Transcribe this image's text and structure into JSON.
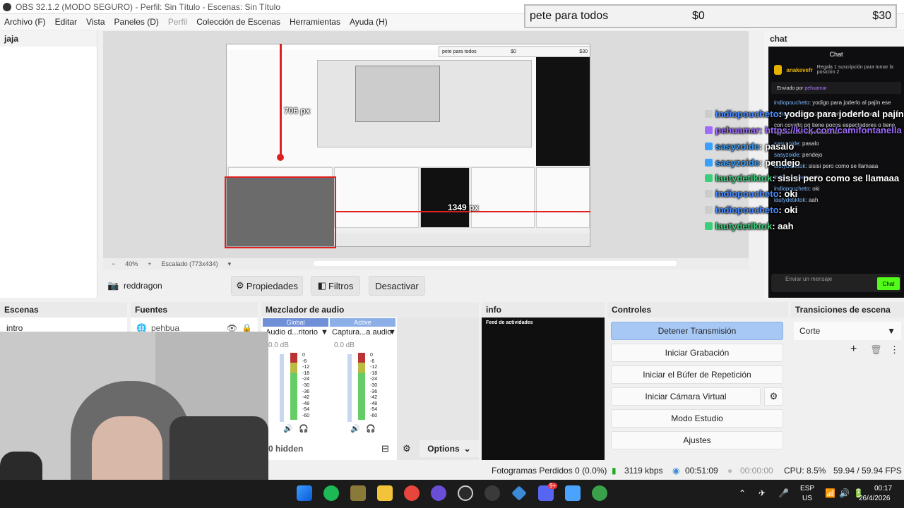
{
  "window": {
    "title": "OBS 32.1.2 (MODO SEGURO) - Perfil: Sin Título - Escenas: Sin Título"
  },
  "menu": {
    "items": [
      "Archivo (F)",
      "Editar",
      "Vista",
      "Paneles (D)",
      "Perfil",
      "Colección de Escenas",
      "Herramientas",
      "Ayuda (H)"
    ]
  },
  "donation_bar": {
    "label": "pete para todos",
    "current": "$0",
    "goal": "$30"
  },
  "left_panel": {
    "item": "jaja"
  },
  "preview": {
    "measure_v": "706 px",
    "measure_h": "1349 px",
    "zoom": "40%",
    "scale": "Escalado (773x434)"
  },
  "source_toolbar": {
    "source_name": "reddragon",
    "properties": "Propiedades",
    "filters": "Filtros",
    "deactivate": "Desactivar"
  },
  "chat_dock": {
    "title": "chat",
    "inner_title": "Chat",
    "gift_user": "anakevefr",
    "gift_text": "Regala 1 suscripción para tomar la posición 2",
    "sent_by": "Enviado por",
    "sent_user": "pehuamar",
    "messages": [
      {
        "user": "indiopoucheto",
        "text": "yodigo para joderlo al pajín ese"
      },
      {
        "user": "pehuamar",
        "text": "https://kick.com/camifontanella"
      },
      {
        "user": "",
        "text": "con covalto pq tiene pocos espectadores o tiene alguien con espectadores"
      },
      {
        "user": "sasyzoide",
        "text": "pasalo"
      },
      {
        "user": "sasyzoide",
        "text": "pendejo"
      },
      {
        "user": "lautydetiktok",
        "text": "sisisi pero como se llamaaa"
      },
      {
        "user": "indiopoucheto",
        "text": "oki"
      },
      {
        "user": "indiopoucheto",
        "text": "oki"
      },
      {
        "user": "lautydetiktok",
        "text": "aah"
      }
    ],
    "input_placeholder": "Enviar un mensaje",
    "send_label": "Chat"
  },
  "overlay_chat": [
    {
      "user": "indiopoucheto",
      "text": ": yodigo para joderlo al pajín ese"
    },
    {
      "user": "pehuamar",
      "text": ": https://kick.com/camifontanella"
    },
    {
      "user": "sasyzoide",
      "text": ": pasalo"
    },
    {
      "user": "sasyzoide",
      "text": ": pendejo"
    },
    {
      "user": "lautydetiktok",
      "text": ": sisisi pero como se llamaaa"
    },
    {
      "user": "indiopoucheto",
      "text": ": oki"
    },
    {
      "user": "indiopoucheto",
      "text": ": oki"
    },
    {
      "user": "lautydetiktok",
      "text": ": aah"
    }
  ],
  "docks": {
    "scenes": {
      "title": "Escenas",
      "item": "intro"
    },
    "sources": {
      "title": "Fuentes",
      "item": "pehbua"
    },
    "mixer": {
      "title": "Mezclador de audio",
      "tab_global": "Global",
      "tab_active": "Active",
      "ch1_name": "Audio d...ritorio",
      "ch2_name": "Captura...a audio",
      "ch1_db": "0.0 dB",
      "ch2_db": "0.0 dB",
      "scale": [
        "0",
        "-6",
        "-12",
        "-18",
        "-24",
        "-30",
        "-36",
        "-42",
        "-48",
        "-54",
        "-60"
      ],
      "hidden": "0 hidden",
      "options": "Options"
    },
    "info": {
      "title": "info",
      "feed": "Feed de actividades"
    },
    "controls": {
      "title": "Controles",
      "stop_stream": "Detener Transmisión",
      "start_record": "Iniciar Grabación",
      "start_replay": "Iniciar el Búfer de Repetición",
      "start_vcam": "Iniciar Cámara Virtual",
      "studio": "Modo Estudio",
      "settings": "Ajustes"
    },
    "transitions": {
      "title": "Transiciones de escena",
      "selected": "Corte"
    }
  },
  "status": {
    "dropped": "Fotogramas Perdidos 0 (0.0%)",
    "bitrate": "3119 kbps",
    "stream_time": "00:51:09",
    "record_time": "00:00:00",
    "cpu": "CPU: 8.5%",
    "fps": "59.94 / 59.94 FPS"
  },
  "taskbar": {
    "lang": "ESP",
    "region": "US",
    "time": "00:17",
    "date": "26/4/2026",
    "discord_badge": "9+"
  }
}
